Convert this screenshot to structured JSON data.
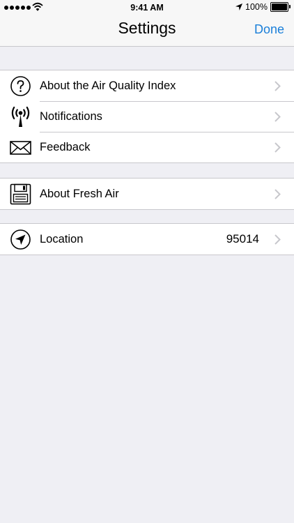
{
  "status_bar": {
    "time": "9:41 AM",
    "battery": "100%"
  },
  "nav": {
    "title": "Settings",
    "done_label": "Done",
    "accent_color": "#1a7fd9"
  },
  "sections": [
    {
      "rows": [
        {
          "label": "About the Air Quality Index",
          "icon": "question-circle-icon"
        },
        {
          "label": "Notifications",
          "icon": "antenna-icon"
        },
        {
          "label": "Feedback",
          "icon": "envelope-icon"
        }
      ]
    },
    {
      "rows": [
        {
          "label": "About Fresh Air",
          "icon": "floppy-disk-icon"
        }
      ]
    },
    {
      "rows": [
        {
          "label": "Location",
          "value": "95014",
          "icon": "location-arrow-icon"
        }
      ]
    }
  ]
}
